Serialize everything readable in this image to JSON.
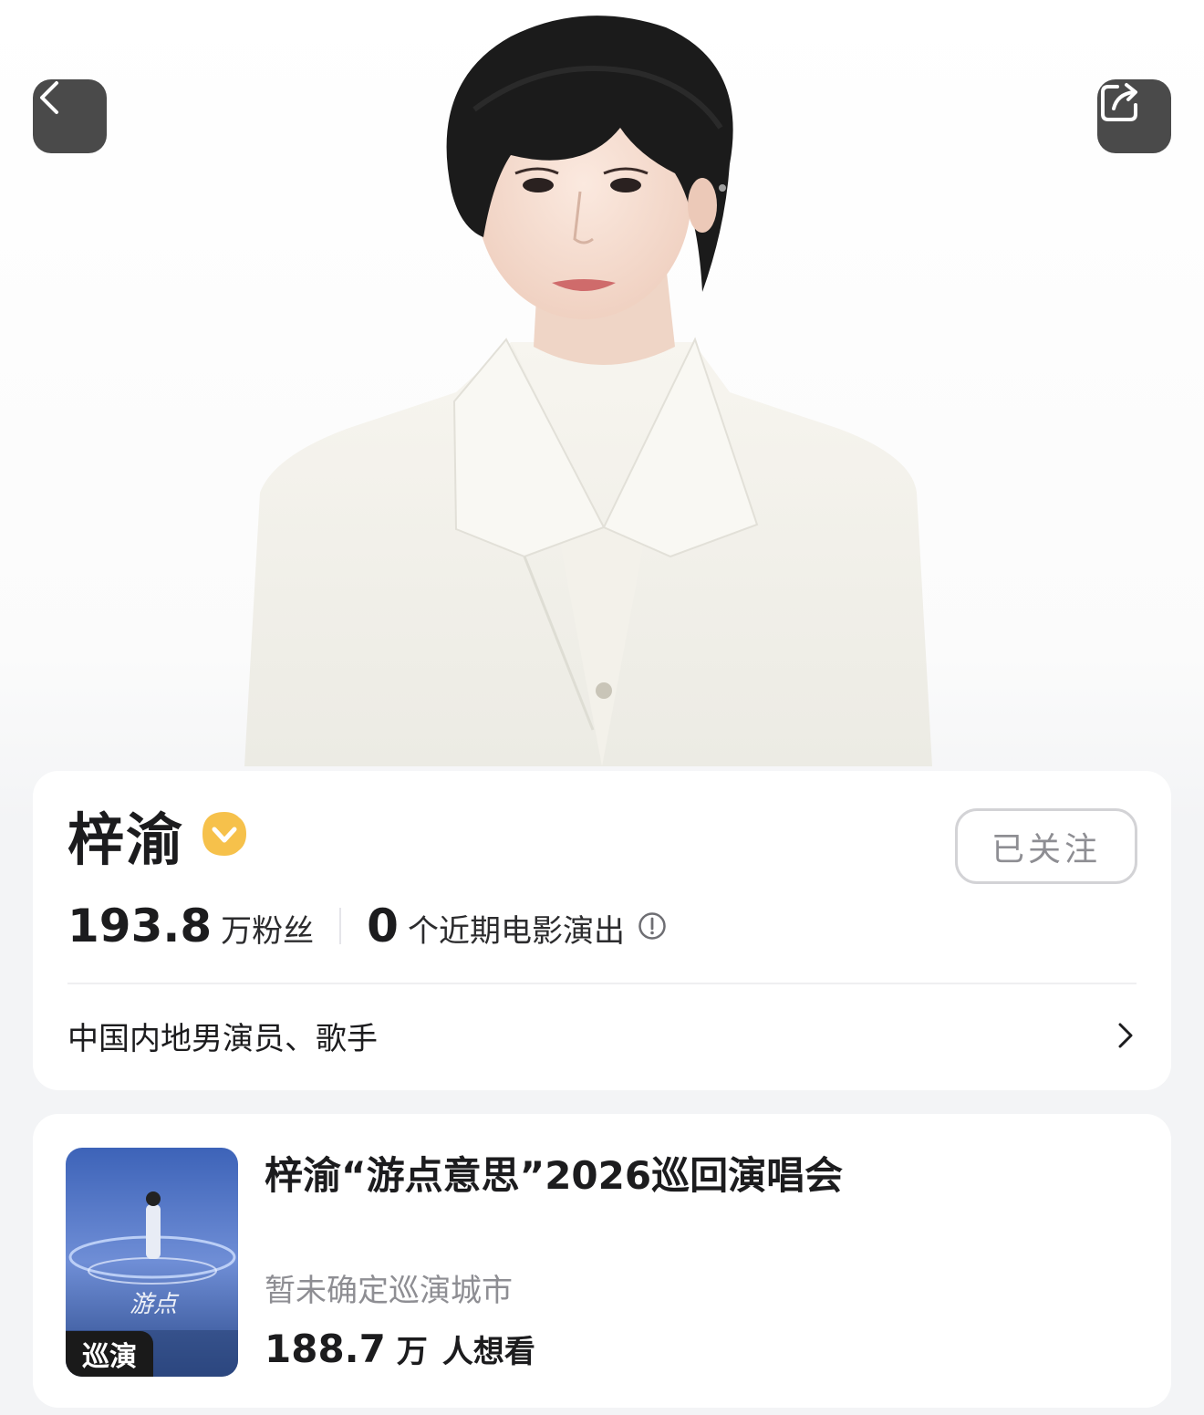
{
  "header": {
    "back_icon": "chevron-left-icon",
    "share_icon": "share-icon",
    "hero_image": "portrait-photo"
  },
  "profile": {
    "name": "梓渝",
    "verified_icon": "verified-badge-icon",
    "follow_label": "已关注",
    "fans_count": "193.8",
    "fans_unit": "万粉丝",
    "movies_count": "0",
    "movies_unit": "个近期电影演出",
    "info_icon": "info-icon",
    "description": "中国内地男演员、歌手",
    "chevron_icon": "chevron-right-icon"
  },
  "event": {
    "poster_tag": "巡演",
    "title": "梓渝“游点意思”2026巡回演唱会",
    "subtitle": "暂未确定巡演城市",
    "want_count": "188.7",
    "want_unit": "万",
    "want_text": "人想看"
  },
  "colors": {
    "background": "#f3f4f6",
    "card": "#ffffff",
    "nav_button": "#4a4a4a",
    "verified_badge": "#f6c14b",
    "muted_text": "#8e8e93"
  }
}
